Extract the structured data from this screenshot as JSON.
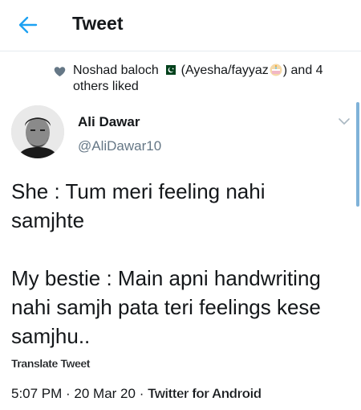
{
  "header": {
    "title": "Tweet"
  },
  "social_context": {
    "line1_prefix": "Noshad baloch",
    "line1_middle": "(Ayesha/fayyaz",
    "line1_suffix": ") and 4",
    "line2": "others liked"
  },
  "author": {
    "name": "Ali Dawar",
    "handle": "@AliDawar10"
  },
  "tweet": {
    "text": "She : Tum meri feeling nahi\nsamjhte\n\nMy bestie : Main apni handwriting\nnahi samjh pata teri feelings kese\nsamjhu.."
  },
  "translate_label": "Translate Tweet",
  "meta": {
    "time": "5:07 PM",
    "separator": " · ",
    "date": "20 Mar 20",
    "source": "Twitter for Android"
  },
  "colors": {
    "accent": "#1da1f2",
    "text": "#14171a",
    "muted": "#657786"
  },
  "icons": [
    "back-arrow-icon",
    "heart-icon",
    "pakistan-flag-icon",
    "cake-icon",
    "chevron-down-icon"
  ]
}
